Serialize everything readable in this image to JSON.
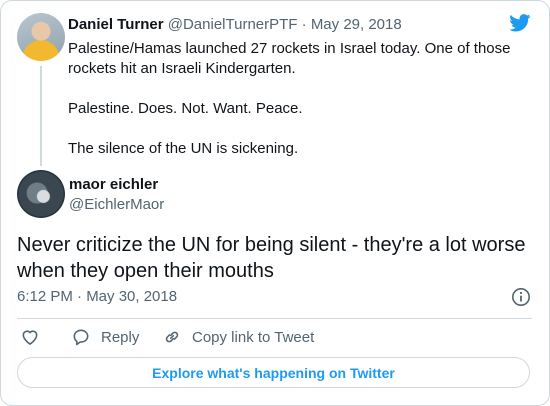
{
  "parent_tweet": {
    "author_name": "Daniel Turner",
    "handle": "@DanielTurnerPTF",
    "separator": " · ",
    "date": "May 29, 2018",
    "lines": [
      "Palestine/Hamas launched 27 rockets in Israel today. One of those rockets hit an Israeli Kindergarten.",
      "Palestine. Does. Not. Want. Peace.",
      "The silence of the UN is sickening."
    ]
  },
  "reply_tweet": {
    "author_name": "maor eichler",
    "handle": "@EichlerMaor",
    "text": "Never criticize the UN for being silent - they're a lot worse when they open their mouths",
    "timestamp": "6:12 PM · May 30, 2018"
  },
  "actions": {
    "reply_label": "Reply",
    "copy_label": "Copy link to Tweet"
  },
  "explore_label": "Explore what's happening on Twitter",
  "colors": {
    "accent": "#1d9bf0",
    "muted": "#536471",
    "border": "#cfd9de"
  },
  "icons": [
    "twitter-bird-icon",
    "info-icon",
    "heart-icon",
    "reply-icon",
    "link-icon"
  ]
}
